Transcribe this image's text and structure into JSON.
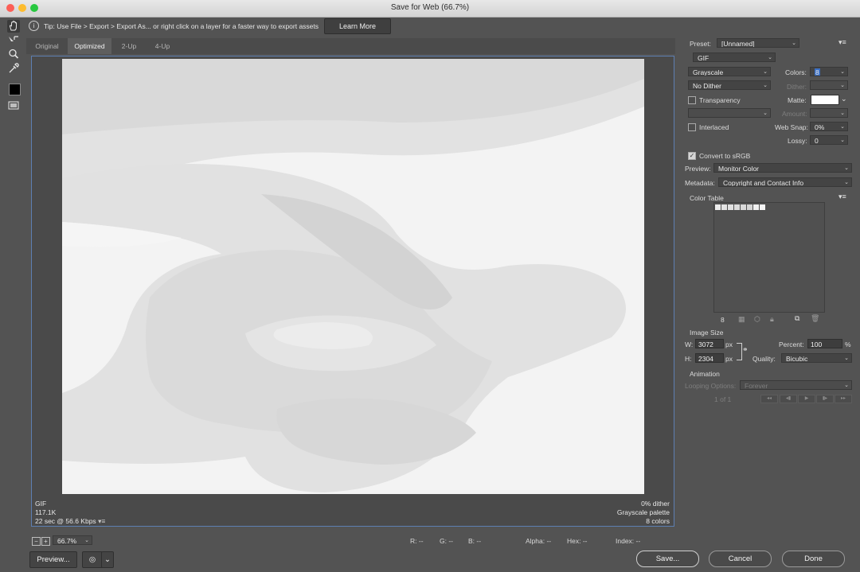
{
  "window": {
    "title": "Save for Web (66.7%)"
  },
  "tip": {
    "text": "Tip: Use File > Export > Export As... or right click on a layer for a faster way to export assets",
    "learn_more": "Learn More"
  },
  "tools": [
    "hand-tool-icon",
    "slice-select-tool-icon",
    "zoom-tool-icon",
    "eyedropper-tool-icon",
    "eyedropper-color-swatch",
    "toggle-slices-icon"
  ],
  "tabs": [
    "Original",
    "Optimized",
    "2-Up",
    "4-Up"
  ],
  "active_tab": "Optimized",
  "image_info": {
    "format": "GIF",
    "size": "117.1K",
    "time": "22 sec @ 56.6 Kbps",
    "dither": "0% dither",
    "palette": "Grayscale palette",
    "colors": "8 colors"
  },
  "status": {
    "zoom": "66.7%",
    "r": "R: --",
    "g": "G: --",
    "b": "B: --",
    "alpha": "Alpha: --",
    "hex": "Hex: --",
    "index": "Index: --"
  },
  "buttons": {
    "preview": "Preview...",
    "save": "Save...",
    "cancel": "Cancel",
    "done": "Done"
  },
  "settings": {
    "preset_label": "Preset:",
    "preset_value": "[Unnamed]",
    "format": "GIF",
    "reduction": "Grayscale",
    "colors_label": "Colors:",
    "colors_value": "8",
    "dither_algo": "No Dither",
    "dither_label": "Dither:",
    "transparency_label": "Transparency",
    "matte_label": "Matte:",
    "amount_label": "Amount:",
    "interlaced_label": "Interlaced",
    "websnap_label": "Web Snap:",
    "websnap_value": "0%",
    "lossy_label": "Lossy:",
    "lossy_value": "0",
    "convert_srgb_label": "Convert to sRGB",
    "preview_label": "Preview:",
    "preview_value": "Monitor Color",
    "metadata_label": "Metadata:",
    "metadata_value": "Copyright and Contact Info"
  },
  "color_table": {
    "heading": "Color Table",
    "count": "8",
    "swatches": [
      "#ebebeb",
      "#e4e4e4",
      "#e0e0e0",
      "#dcdcdc",
      "#d8d8d8",
      "#d4d4d4",
      "#f0f0f0",
      "#f5f5f5"
    ]
  },
  "image_size": {
    "heading": "Image Size",
    "w_label": "W:",
    "w_value": "3072",
    "h_label": "H:",
    "h_value": "2304",
    "unit": "px",
    "percent_label": "Percent:",
    "percent_value": "100",
    "percent_unit": "%",
    "quality_label": "Quality:",
    "quality_value": "Bicubic"
  },
  "animation": {
    "heading": "Animation",
    "looping_label": "Looping Options:",
    "looping_value": "Forever",
    "frame": "1 of 1"
  }
}
